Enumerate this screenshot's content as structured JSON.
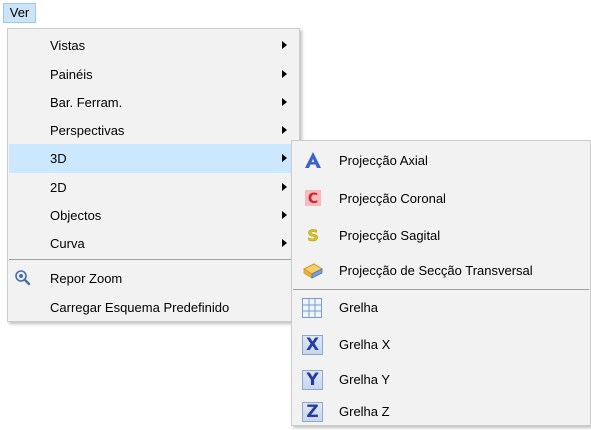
{
  "menubar": {
    "ver_label": "Ver"
  },
  "main_menu": {
    "items": [
      {
        "label": "Vistas"
      },
      {
        "label": "Painéis"
      },
      {
        "label": "Bar. Ferram."
      },
      {
        "label": "Perspectivas"
      },
      {
        "label": "3D"
      },
      {
        "label": "2D"
      },
      {
        "label": "Objectos"
      },
      {
        "label": "Curva"
      }
    ],
    "repor_zoom": "Repor Zoom",
    "carregar_esquema": "Carregar Esquema Predefinido"
  },
  "submenu_3d": {
    "items": [
      {
        "label": "Projecção Axial",
        "icon_letter": "A",
        "icon": "axial-projection-icon"
      },
      {
        "label": "Projecção Coronal",
        "icon_letter": "C",
        "icon": "coronal-projection-icon"
      },
      {
        "label": "Projecção Sagital",
        "icon_letter": "S",
        "icon": "sagittal-projection-icon"
      },
      {
        "label": "Projecção de Secção Transversal",
        "icon": "cross-section-icon"
      }
    ],
    "grid_items": [
      {
        "label": "Grelha",
        "icon": "grid-icon"
      },
      {
        "label": "Grelha X",
        "icon_letter": "X",
        "icon": "grid-x-icon"
      },
      {
        "label": "Grelha Y",
        "icon_letter": "Y",
        "icon": "grid-y-icon"
      },
      {
        "label": "Grelha Z",
        "icon_letter": "Z",
        "icon": "grid-z-icon"
      }
    ]
  },
  "colors": {
    "highlight": "#cce8ff",
    "menu_bg": "#f2f2f2",
    "icon_letter": "#2a3a9e"
  }
}
